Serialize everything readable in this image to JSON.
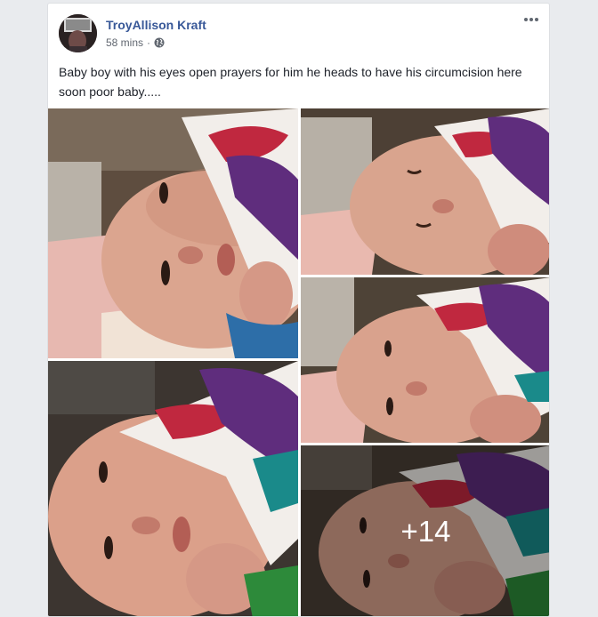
{
  "post": {
    "author": "TroyAllison Kraft",
    "timestamp": "58 mins",
    "separator": "·",
    "privacy_icon": "globe-icon",
    "more_icon": "more-options-icon",
    "caption": "Baby boy with his eyes open prayers for him he heads to have his circumcision here soon poor baby.....",
    "photos": [
      {
        "name": "photo-1",
        "eyes": "open"
      },
      {
        "name": "photo-2",
        "eyes": "closed"
      },
      {
        "name": "photo-3",
        "eyes": "open"
      },
      {
        "name": "photo-4",
        "eyes": "open"
      },
      {
        "name": "photo-5",
        "eyes": "open",
        "overlay": "+14"
      }
    ],
    "colors": {
      "author_link": "#385898",
      "meta_text": "#616770",
      "caption_text": "#1d2129",
      "feed_background": "#e9ebee"
    }
  }
}
